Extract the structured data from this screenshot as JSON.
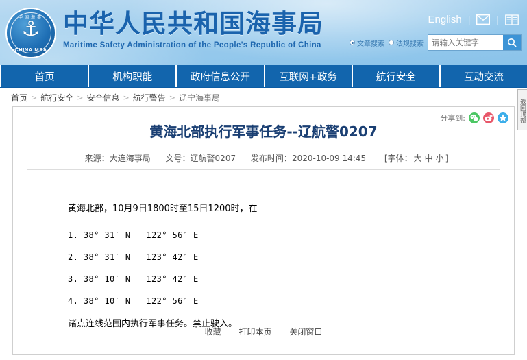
{
  "header": {
    "logo": {
      "cn_arc": "中国海事",
      "en_arc": "CHINA MSA",
      "anchor_icon": "anchor-icon"
    },
    "brand_cn": "中华人民共和国海事局",
    "brand_en": "Maritime Safety Administration of the People's Republic of China",
    "english_link": "English",
    "separator": "|",
    "mail_icon": "envelope-icon",
    "book_icon": "book-icon",
    "search": {
      "radio_options": [
        {
          "label": "文章搜索",
          "checked": true
        },
        {
          "label": "法规搜索",
          "checked": false
        }
      ],
      "placeholder": "请输入关键字",
      "value": "",
      "button_icon": "search-icon"
    }
  },
  "nav": {
    "items": [
      {
        "label": "首页"
      },
      {
        "label": "机构职能"
      },
      {
        "label": "政府信息公开"
      },
      {
        "label": "互联网+政务"
      },
      {
        "label": "航行安全"
      },
      {
        "label": "互动交流"
      }
    ]
  },
  "breadcrumb": {
    "separator": ">",
    "items": [
      {
        "label": "首页"
      },
      {
        "label": "航行安全"
      },
      {
        "label": "安全信息"
      },
      {
        "label": "航行警告"
      },
      {
        "label": "辽宁海事局"
      }
    ]
  },
  "article": {
    "share_label": "分享到:",
    "share_icons": [
      {
        "name": "wechat-icon",
        "color": "#4cc764"
      },
      {
        "name": "weibo-icon",
        "color": "#e8576a"
      },
      {
        "name": "qzone-icon",
        "color": "#3caeea"
      }
    ],
    "title": "黄海北部执行军事任务--辽航警0207",
    "meta": {
      "source_label": "来源：",
      "source_value": "大连海事局",
      "docno_label": "文号：",
      "docno_value": "辽航警0207",
      "time_label": "发布时间：",
      "time_value": "2020-10-09 14:45",
      "fontsize_prefix": "[字体：",
      "fontsize_large": "大",
      "fontsize_medium": "中",
      "fontsize_small": "小",
      "fontsize_suffix": "]"
    },
    "body": {
      "intro": "黄海北部，10月9日1800时至15日1200时，在",
      "coordinates": [
        "1. 38° 31′ N   122° 56′ E",
        "2. 38° 31′ N   123° 42′ E",
        "3. 38° 10′ N   123° 42′ E",
        "4. 38° 10′ N   122° 56′ E"
      ],
      "conclusion": "诸点连线范围内执行军事任务。禁止驶入。"
    },
    "footer_links": [
      {
        "label": "收藏"
      },
      {
        "label": "打印本页"
      },
      {
        "label": "关闭窗口"
      }
    ]
  },
  "side_tab": {
    "label": "返回顶部"
  }
}
